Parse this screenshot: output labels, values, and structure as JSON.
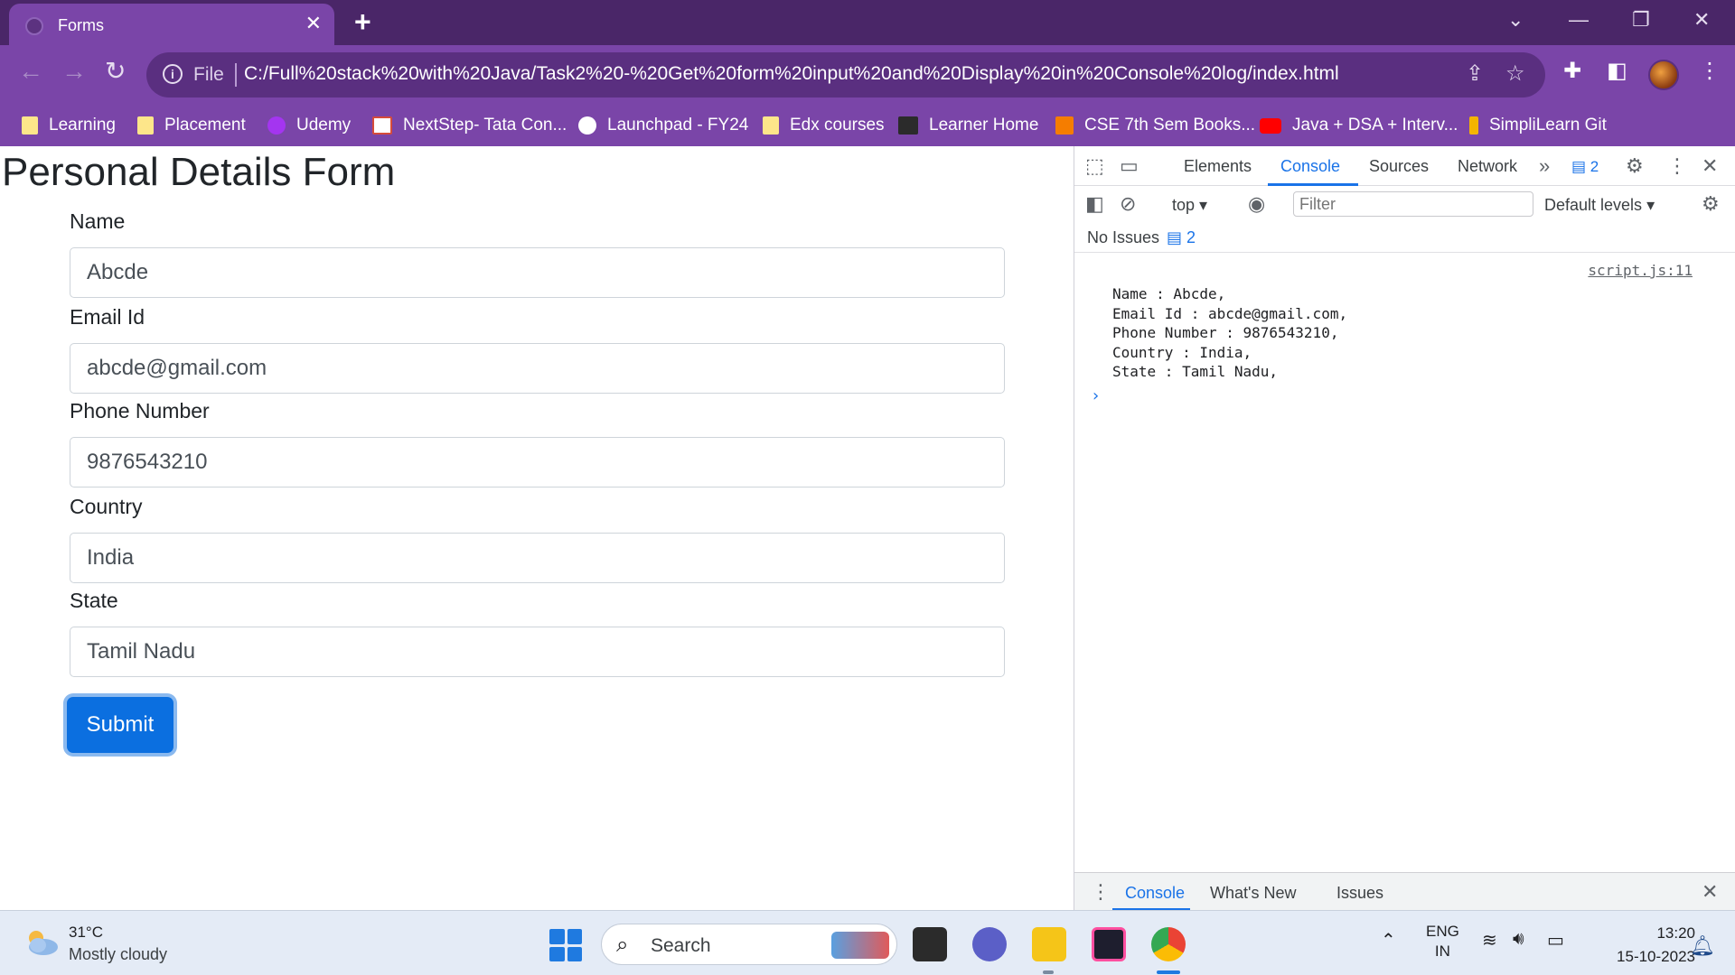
{
  "browser": {
    "tab_title": "Forms",
    "address": {
      "scheme_label": "File",
      "url": "C:/Full%20stack%20with%20Java/Task2%20-%20Get%20form%20input%20and%20Display%20in%20Console%20log/index.html"
    },
    "bookmarks": [
      {
        "label": "Learning",
        "icon": "folder-icon"
      },
      {
        "label": "Placement",
        "icon": "folder-icon"
      },
      {
        "label": "Udemy",
        "icon": "udemy-icon"
      },
      {
        "label": "NextStep- Tata Con...",
        "icon": "tcs-icon"
      },
      {
        "label": "Launchpad - FY24",
        "icon": "globe-icon"
      },
      {
        "label": "Edx courses",
        "icon": "folder-icon"
      },
      {
        "label": "Learner Home",
        "icon": "edx-icon"
      },
      {
        "label": "CSE 7th Sem Books...",
        "icon": "blogger-icon"
      },
      {
        "label": "Java + DSA + Interv...",
        "icon": "youtube-icon"
      },
      {
        "label": "SimpliLearn Git",
        "icon": "simplilearn-icon"
      }
    ]
  },
  "form": {
    "title": "Personal Details Form",
    "fields": [
      {
        "label": "Name",
        "value": "Abcde"
      },
      {
        "label": "Email Id",
        "value": "abcde@gmail.com"
      },
      {
        "label": "Phone Number",
        "value": "9876543210"
      },
      {
        "label": "Country",
        "value": "India"
      },
      {
        "label": "State",
        "value": "Tamil Nadu"
      }
    ],
    "submit_label": "Submit"
  },
  "devtools": {
    "tabs": [
      "Elements",
      "Console",
      "Sources",
      "Network"
    ],
    "active_tab": "Console",
    "issue_badge": "2",
    "context": "top",
    "filter_placeholder": "Filter",
    "levels": "Default levels",
    "issues_text": "No Issues",
    "issues_count": "2",
    "log_source": "script.js:11",
    "log_lines": [
      "Name : Abcde,",
      "Email Id : abcde@gmail.com,",
      "Phone Number : 9876543210,",
      "Country : India,",
      "State : Tamil Nadu,"
    ],
    "drawer_tabs": [
      "Console",
      "What's New",
      "Issues"
    ]
  },
  "taskbar": {
    "weather_temp": "31°C",
    "weather_desc": "Mostly cloudy",
    "search_label": "Search",
    "lang_top": "ENG",
    "lang_bottom": "IN",
    "time": "13:20",
    "date": "15-10-2023"
  },
  "colors": {
    "browser_frame": "#4a2668",
    "toolbar": "#7a45a8",
    "submit": "#0b6fe0",
    "devtools_accent": "#1a73e8"
  }
}
